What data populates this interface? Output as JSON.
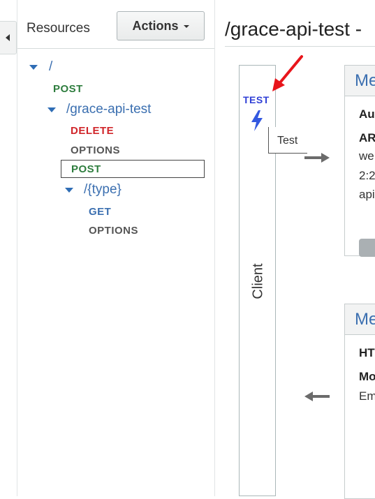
{
  "sidebar": {
    "title": "Resources",
    "actions_label": "Actions",
    "tree": {
      "root_path": "/",
      "root_post": "POST",
      "child_path": "/grace-api-test",
      "child_delete": "DELETE",
      "child_options": "OPTIONS",
      "child_post": "POST",
      "grandchild_path": "/{type}",
      "grandchild_get": "GET",
      "grandchild_options": "OPTIONS"
    }
  },
  "main": {
    "title": "/grace-api-test - ",
    "client": {
      "test_label": "TEST",
      "tooltip": "Test",
      "column_label": "Client"
    },
    "method_request": {
      "heading": "Me",
      "line1": "Au",
      "line2": "AR",
      "line3": "we",
      "line4": "2:2",
      "line5": "api"
    },
    "method_response": {
      "heading": "Me",
      "line1": "HT",
      "line2": "Mo",
      "line3": "Em"
    }
  },
  "colors": {
    "post": "#2e7d3e",
    "delete": "#d0252a",
    "options": "#555555",
    "get": "#3b6fb0",
    "link": "#3b6fb0",
    "annotation_arrow": "#e8151b"
  }
}
